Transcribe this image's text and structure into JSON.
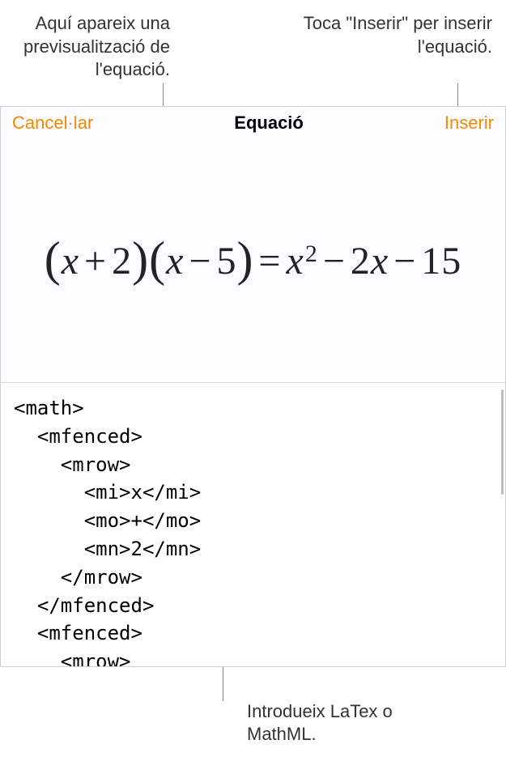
{
  "callouts": {
    "preview": "Aquí apareix una previsualització de l'equació.",
    "insert": "Toca \"Inserir\" per inserir l'equació.",
    "code": "Introdueix LaTex o MathML."
  },
  "navbar": {
    "cancel": "Cancel·lar",
    "title": "Equació",
    "insert": "Inserir"
  },
  "equation": {
    "lp1": "(",
    "x1": "x",
    "plus1": "+",
    "two": "2",
    "rp1": ")",
    "lp2": "(",
    "x2": "x",
    "minus1": "−",
    "five": "5",
    "rp2": ")",
    "eq": "=",
    "x3": "x",
    "sq": "2",
    "minus2": "−",
    "twoCoef": "2",
    "x4": "x",
    "minus3": "−",
    "fifteen": "15"
  },
  "code": "<math>\n  <mfenced>\n    <mrow>\n      <mi>x</mi>\n      <mo>+</mo>\n      <mn>2</mn>\n    </mrow>\n  </mfenced>\n  <mfenced>\n    <mrow>"
}
